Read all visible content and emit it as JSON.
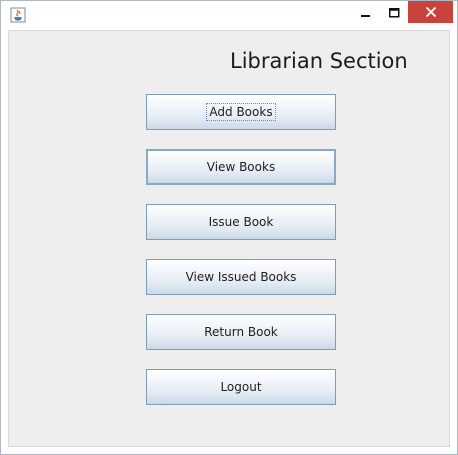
{
  "window": {
    "title": "",
    "controls": {
      "minimize_icon": "minimize-icon",
      "maximize_icon": "maximize-icon",
      "close_icon": "close-icon",
      "close_color": "#c8433b"
    }
  },
  "main": {
    "heading": "Librarian Section",
    "buttons": [
      {
        "label": "Add Books"
      },
      {
        "label": "View Books"
      },
      {
        "label": "Issue Book"
      },
      {
        "label": "View Issued Books"
      },
      {
        "label": "Return Book"
      },
      {
        "label": "Logout"
      }
    ]
  }
}
